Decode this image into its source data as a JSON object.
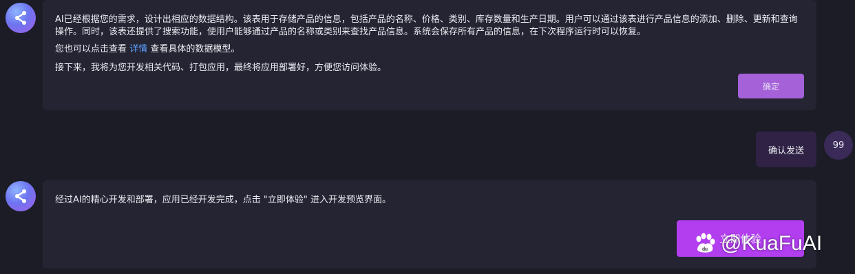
{
  "messages": {
    "first": {
      "para1": "AI已经根据您的需求，设计出相应的数据结构。该表用于存储产品的信息，包括产品的名称、价格、类别、库存数量和生产日期。用户可以通过该表进行产品信息的添加、删除、更新和查询操作。同时，该表还提供了搜索功能，使用户能够通过产品的名称或类别来查找产品信息。系统会保存所有产品的信息，在下次程序运行时可以恢复。",
      "para2_prefix": "您也可以点击查看",
      "para2_link": "详情",
      "para2_suffix": "查看具体的数据模型。",
      "para3": "接下来，我将为您开发相关代码、打包应用，最终将应用部署好，方便您访问体验。",
      "confirm_button": "确定"
    },
    "user": {
      "text": "确认发送",
      "avatar": "99"
    },
    "second": {
      "text": "经过AI的精心开发和部署，应用已经开发完成，点击 \"立即体验\" 进入开发预览界面。",
      "try_button": "立即体验"
    }
  },
  "watermark": {
    "text": "@KuaFuAI",
    "icon": "baidu-paw-icon"
  },
  "icons": {
    "ai_avatar": "share-icon"
  },
  "colors": {
    "background": "#1c1c27",
    "bubble": "#242433",
    "confirm_button": "#a461d8",
    "try_button": "#b23ef0",
    "link": "#5ea3ff",
    "user_bubble": "#2f2244"
  }
}
